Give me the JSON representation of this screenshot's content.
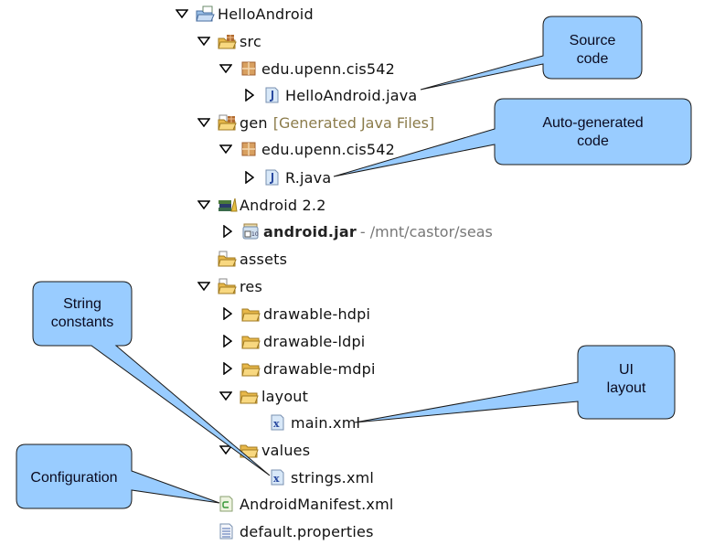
{
  "tree": {
    "items": [
      {
        "label": "HelloAndroid",
        "icon": "project-folder-icon",
        "toggle": "expanded"
      },
      {
        "label": "src",
        "icon": "source-folder-icon",
        "toggle": "expanded"
      },
      {
        "label": "edu.upenn.cis542",
        "icon": "package-icon",
        "toggle": "expanded"
      },
      {
        "label": "HelloAndroid.java",
        "icon": "java-file-icon",
        "toggle": "collapsed"
      },
      {
        "label": "gen",
        "decoration": "[Generated Java Files]",
        "icon": "gen-folder-icon",
        "toggle": "expanded"
      },
      {
        "label": "edu.upenn.cis542",
        "icon": "package-icon",
        "toggle": "expanded"
      },
      {
        "label": "R.java",
        "icon": "java-file-icon",
        "toggle": "collapsed"
      },
      {
        "label": "Android 2.2",
        "icon": "library-icon",
        "toggle": "expanded"
      },
      {
        "label": "android.jar",
        "path": "- /mnt/castor/seas",
        "icon": "jar-icon",
        "toggle": "collapsed"
      },
      {
        "label": "assets",
        "icon": "folder-icon",
        "toggle": "none"
      },
      {
        "label": "res",
        "icon": "folder-icon",
        "toggle": "expanded"
      },
      {
        "label": "drawable-hdpi",
        "icon": "open-folder-icon",
        "toggle": "collapsed"
      },
      {
        "label": "drawable-ldpi",
        "icon": "open-folder-icon",
        "toggle": "collapsed"
      },
      {
        "label": "drawable-mdpi",
        "icon": "open-folder-icon",
        "toggle": "collapsed"
      },
      {
        "label": "layout",
        "icon": "open-folder-icon",
        "toggle": "expanded"
      },
      {
        "label": "main.xml",
        "icon": "xml-file-icon",
        "toggle": "none"
      },
      {
        "label": "values",
        "icon": "open-folder-icon",
        "toggle": "expanded"
      },
      {
        "label": "strings.xml",
        "icon": "xml-file-icon",
        "toggle": "none"
      },
      {
        "label": "AndroidManifest.xml",
        "icon": "manifest-file-icon",
        "toggle": "none"
      },
      {
        "label": "default.properties",
        "icon": "properties-file-icon",
        "toggle": "none"
      }
    ]
  },
  "callouts": {
    "source": {
      "line1": "Source",
      "line2": "code"
    },
    "autogen": {
      "line1": "Auto-generated",
      "line2": "code"
    },
    "strings": {
      "line1": "String",
      "line2": "constants"
    },
    "ui": {
      "line1": "UI",
      "line2": "layout"
    },
    "config": {
      "line1": "Configuration"
    }
  },
  "colors": {
    "callout_fill": "#99ccff",
    "callout_stroke": "#1a1a1a",
    "decoration_text": "#8b7b4a",
    "folder": "#f0c060"
  }
}
